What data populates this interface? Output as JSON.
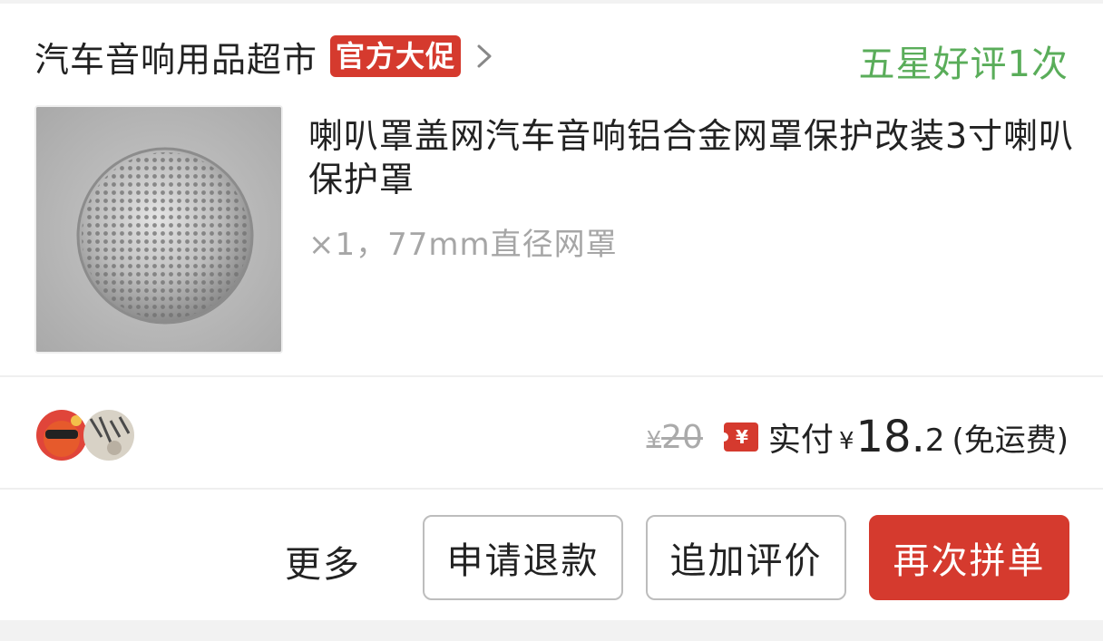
{
  "order": {
    "shop_name": "汽车音响用品超市",
    "promo_badge": "官方大促",
    "review_status": "五星好评1次",
    "product": {
      "title": "喇叭罩盖网汽车音响铝合金网罩保护改装3寸喇叭保护罩",
      "spec": "×1，77mm直径网罩"
    },
    "pricing": {
      "original_currency": "¥",
      "original_amount": "20",
      "paid_label": "实付",
      "paid_currency": "¥",
      "paid_integer": "18.",
      "paid_decimal": "2",
      "shipping_note": "(免运费)"
    },
    "actions": {
      "more": "更多",
      "refund": "申请退款",
      "add_review": "追加评价",
      "reorder": "再次拼单"
    }
  },
  "colors": {
    "accent_red": "#d53a2e",
    "review_green": "#5aad5a",
    "muted_gray": "#a6a6a6"
  },
  "icons": {
    "chevron": "chevron-right-icon",
    "coupon": "coupon-yen-icon"
  }
}
